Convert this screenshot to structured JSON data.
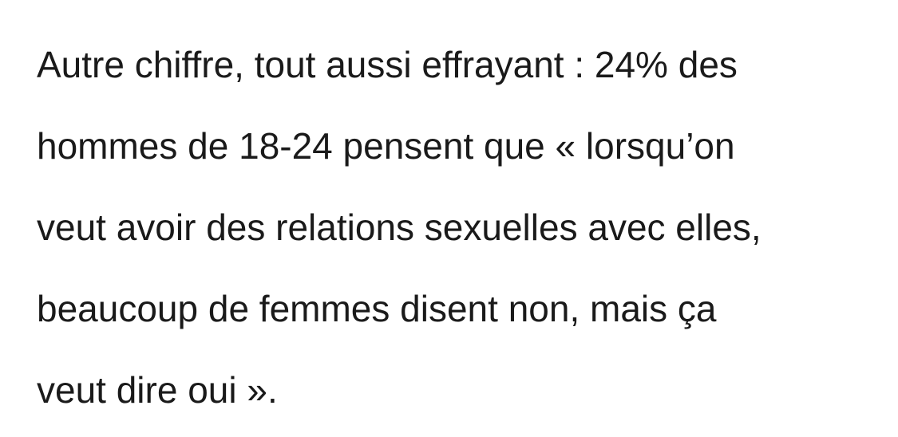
{
  "paragraph": {
    "lines": [
      "Autre chiffre, tout aussi effrayant : 24% des",
      "hommes de 18-24 pensent que « lorsqu’on",
      "veut avoir des relations sexuelles avec elles,",
      "beaucoup de femmes disent non, mais ça",
      "veut dire oui »."
    ]
  }
}
